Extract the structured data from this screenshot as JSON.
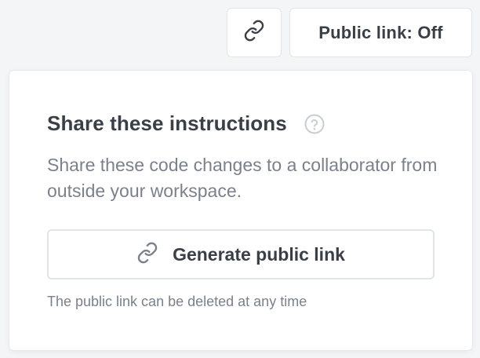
{
  "header": {
    "link_icon": "link-icon",
    "public_link_toggle_label": "Public link: Off"
  },
  "share_panel": {
    "title": "Share these instructions",
    "help_icon": "question-circle-icon",
    "description": "Share these code changes to a collaborator from outside your workspace.",
    "generate_button": {
      "icon": "link-icon",
      "label": "Generate public link"
    },
    "note": "The public link can be deleted at any time"
  },
  "colors": {
    "background": "#f4f5f7",
    "panel_background": "#ffffff",
    "border": "#e1e4e8",
    "text_primary": "#3a3f47",
    "text_secondary": "#7a818c"
  }
}
